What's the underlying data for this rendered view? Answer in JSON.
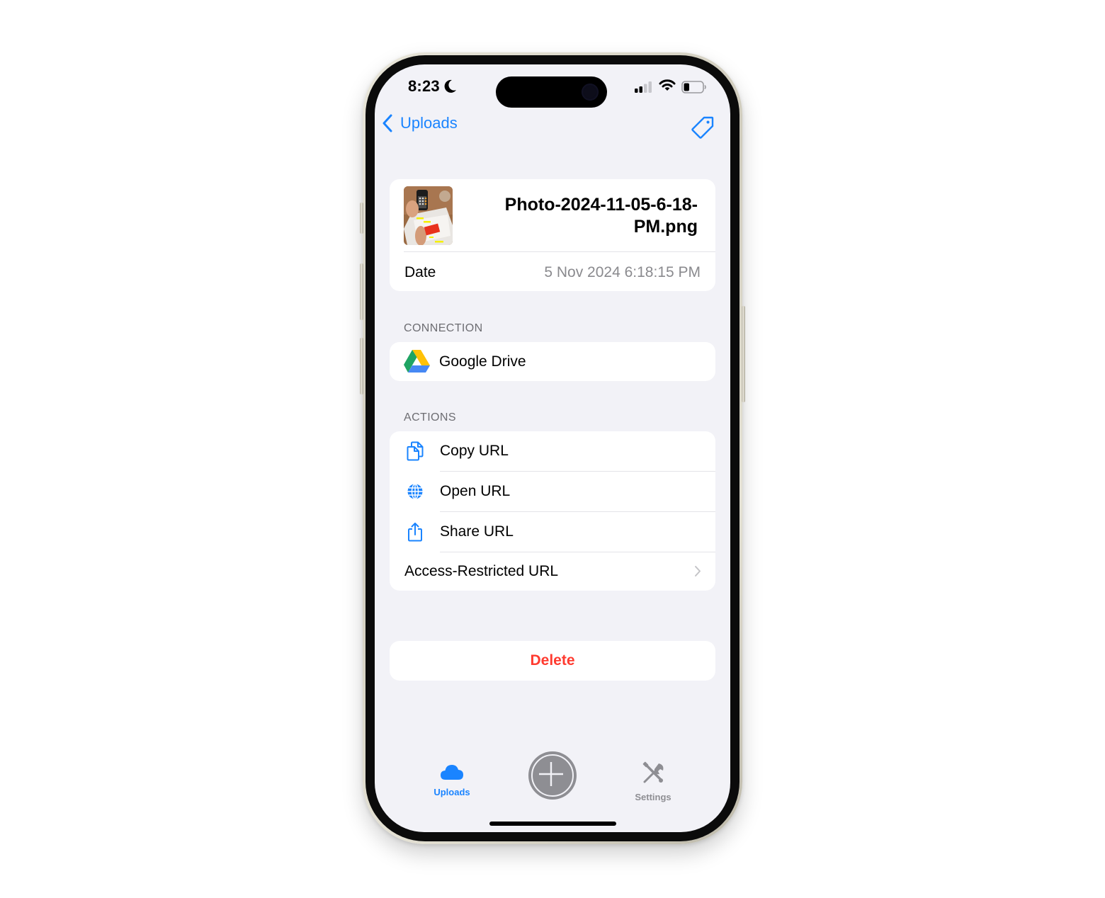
{
  "status_bar": {
    "time": "8:23",
    "focus_icon": "moon-icon",
    "signal_icon": "cellular-signal-icon",
    "wifi_icon": "wifi-icon",
    "battery_icon": "battery-icon",
    "battery_level": 0.3
  },
  "nav": {
    "back_label": "Uploads",
    "back_icon": "chevron-left-icon",
    "right_icon": "tag-icon"
  },
  "file": {
    "thumbnail_icon": "photo-thumbnail",
    "name": "Photo-2024-11-05-6-18-PM.png",
    "date_label": "Date",
    "date_value": "5 Nov 2024 6:18:15 PM"
  },
  "connection": {
    "header": "CONNECTION",
    "service_icon": "google-drive-icon",
    "service_name": "Google Drive"
  },
  "actions": {
    "header": "ACTIONS",
    "items": [
      {
        "label": "Copy URL",
        "icon": "copy-icon"
      },
      {
        "label": "Open URL",
        "icon": "globe-icon"
      },
      {
        "label": "Share URL",
        "icon": "share-icon"
      },
      {
        "label": "Access-Restricted URL",
        "icon": "chevron-right-icon"
      }
    ]
  },
  "delete": {
    "label": "Delete"
  },
  "tab_bar": {
    "tabs": [
      {
        "label": "Uploads",
        "icon": "cloud-icon",
        "active": true
      },
      {
        "label": "",
        "icon": "plus-circle-icon",
        "active": false
      },
      {
        "label": "Settings",
        "icon": "wrench-screwdriver-icon",
        "active": false
      }
    ]
  },
  "colors": {
    "accent": "#1a84ff",
    "destructive": "#ff3b30",
    "background": "#f2f2f7",
    "secondary_text": "#8a8a8e",
    "inactive_tab": "#8e8e93"
  }
}
